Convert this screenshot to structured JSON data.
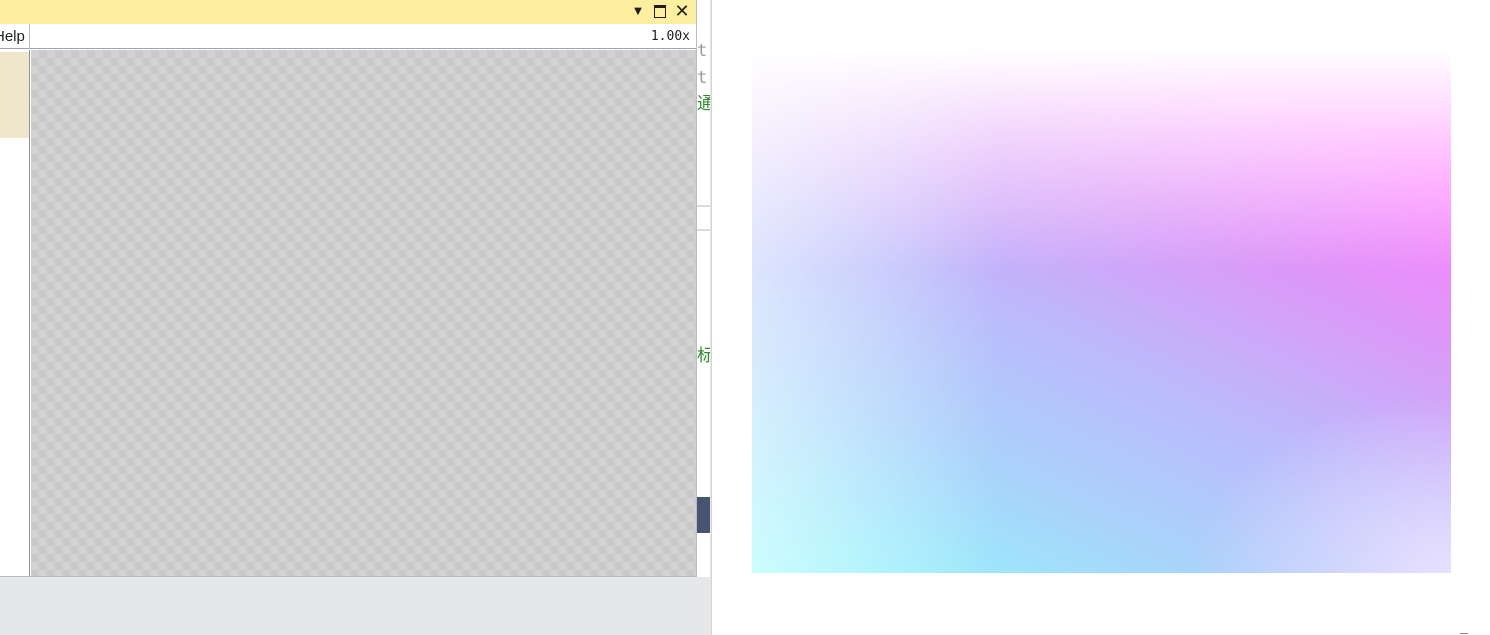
{
  "viewer": {
    "titlebar": {
      "color": "#fdef9f",
      "buttons": [
        {
          "name": "dropdown",
          "glyph": "▼"
        },
        {
          "name": "maximize"
        },
        {
          "name": "close",
          "glyph": "✕"
        }
      ]
    },
    "toolbar": {
      "help_label": "Help",
      "zoom": "1.00x"
    },
    "canvas": {
      "pattern": "checkerboard-transparency"
    }
  },
  "editor": {
    "lines": [
      {
        "text": "t",
        "style": "gray"
      },
      {
        "text": "t",
        "style": "gray"
      },
      {
        "text": "通",
        "style": "green"
      },
      {
        "text": "标",
        "style": "green"
      }
    ]
  },
  "preview": {
    "gradient_colors": [
      "#ffffff",
      "#ff80ff",
      "#bcbafb",
      "#8ffbfb",
      "#e6dcff"
    ]
  }
}
